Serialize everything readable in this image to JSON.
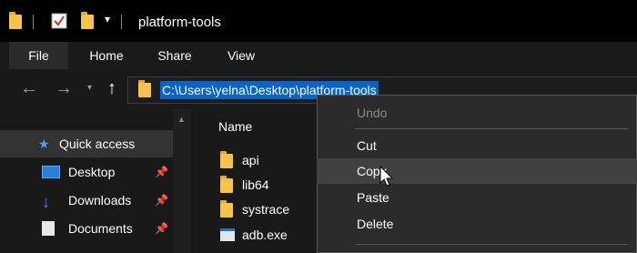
{
  "window": {
    "title": "platform-tools"
  },
  "ribbon": {
    "tabs": [
      "File",
      "Home",
      "Share",
      "View"
    ]
  },
  "address": {
    "path": "C:\\Users\\yelna\\Desktop\\platform-tools"
  },
  "navigation": {
    "items": [
      {
        "label": "Quick access",
        "icon": "star-icon"
      },
      {
        "label": "Desktop",
        "icon": "desktop-icon",
        "pinned": true
      },
      {
        "label": "Downloads",
        "icon": "download-icon",
        "pinned": true
      },
      {
        "label": "Documents",
        "icon": "documents-icon",
        "pinned": true
      }
    ]
  },
  "filelist": {
    "column": "Name",
    "items": [
      {
        "name": "api",
        "type": "folder"
      },
      {
        "name": "lib64",
        "type": "folder"
      },
      {
        "name": "systrace",
        "type": "folder"
      },
      {
        "name": "adb.exe",
        "type": "exe"
      }
    ]
  },
  "context_menu": {
    "items": [
      "Undo",
      "Cut",
      "Copy",
      "Paste",
      "Delete"
    ],
    "disabled": [
      "Undo"
    ],
    "hovered": "Copy"
  },
  "colors": {
    "selection": "#0a64c8",
    "folder": "#f8c34a",
    "menu_bg": "#2b2b2b",
    "hover": "#414141"
  }
}
